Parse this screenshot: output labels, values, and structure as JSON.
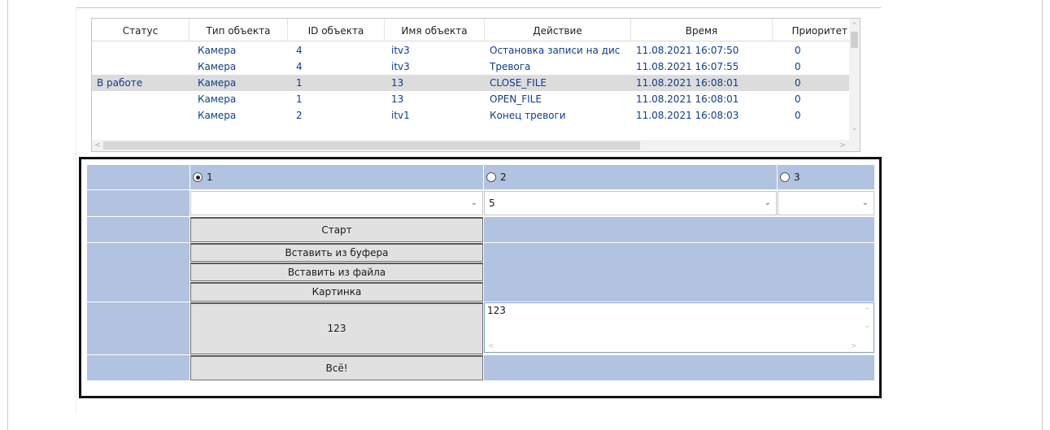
{
  "grid": {
    "columns": [
      "Статус",
      "Тип объекта",
      "ID объекта",
      "Имя объекта",
      "Действие",
      "Время",
      "Приоритет"
    ],
    "rows": [
      {
        "status": "",
        "type": "Камера",
        "id": "4",
        "name": "itv3",
        "action": "Остановка записи на дис",
        "time": "11.08.2021 16:07:50",
        "priority": "0"
      },
      {
        "status": "",
        "type": "Камера",
        "id": "4",
        "name": "itv3",
        "action": "Тревога",
        "time": "11.08.2021 16:07:55",
        "priority": "0"
      },
      {
        "status": "В работе",
        "type": "Камера",
        "id": "1",
        "name": "13",
        "action": "CLOSE_FILE",
        "time": "11.08.2021 16:08:01",
        "priority": "0"
      },
      {
        "status": "",
        "type": "Камера",
        "id": "1",
        "name": "13",
        "action": "OPEN_FILE",
        "time": "11.08.2021 16:08:01",
        "priority": "0"
      },
      {
        "status": "",
        "type": "Камера",
        "id": "2",
        "name": "itv1",
        "action": "Конец тревоги",
        "time": "11.08.2021 16:08:03",
        "priority": "0"
      }
    ],
    "selected_row": 2
  },
  "form": {
    "radios": [
      {
        "label": "1",
        "checked": true
      },
      {
        "label": "2",
        "checked": false
      },
      {
        "label": "3",
        "checked": false
      }
    ],
    "selects": [
      "",
      "5",
      ""
    ],
    "buttons": {
      "start": "Старт",
      "paste_buffer": "Вставить из буфера",
      "paste_file": "Вставить из файла",
      "picture": "Картинка",
      "value_button": "123",
      "done": "Всё!"
    },
    "memo_text": "123"
  },
  "colors": {
    "accent_cell": "#b1c3e0",
    "link_text": "#0f3d8f",
    "selected_row": "#dcdcdc"
  }
}
